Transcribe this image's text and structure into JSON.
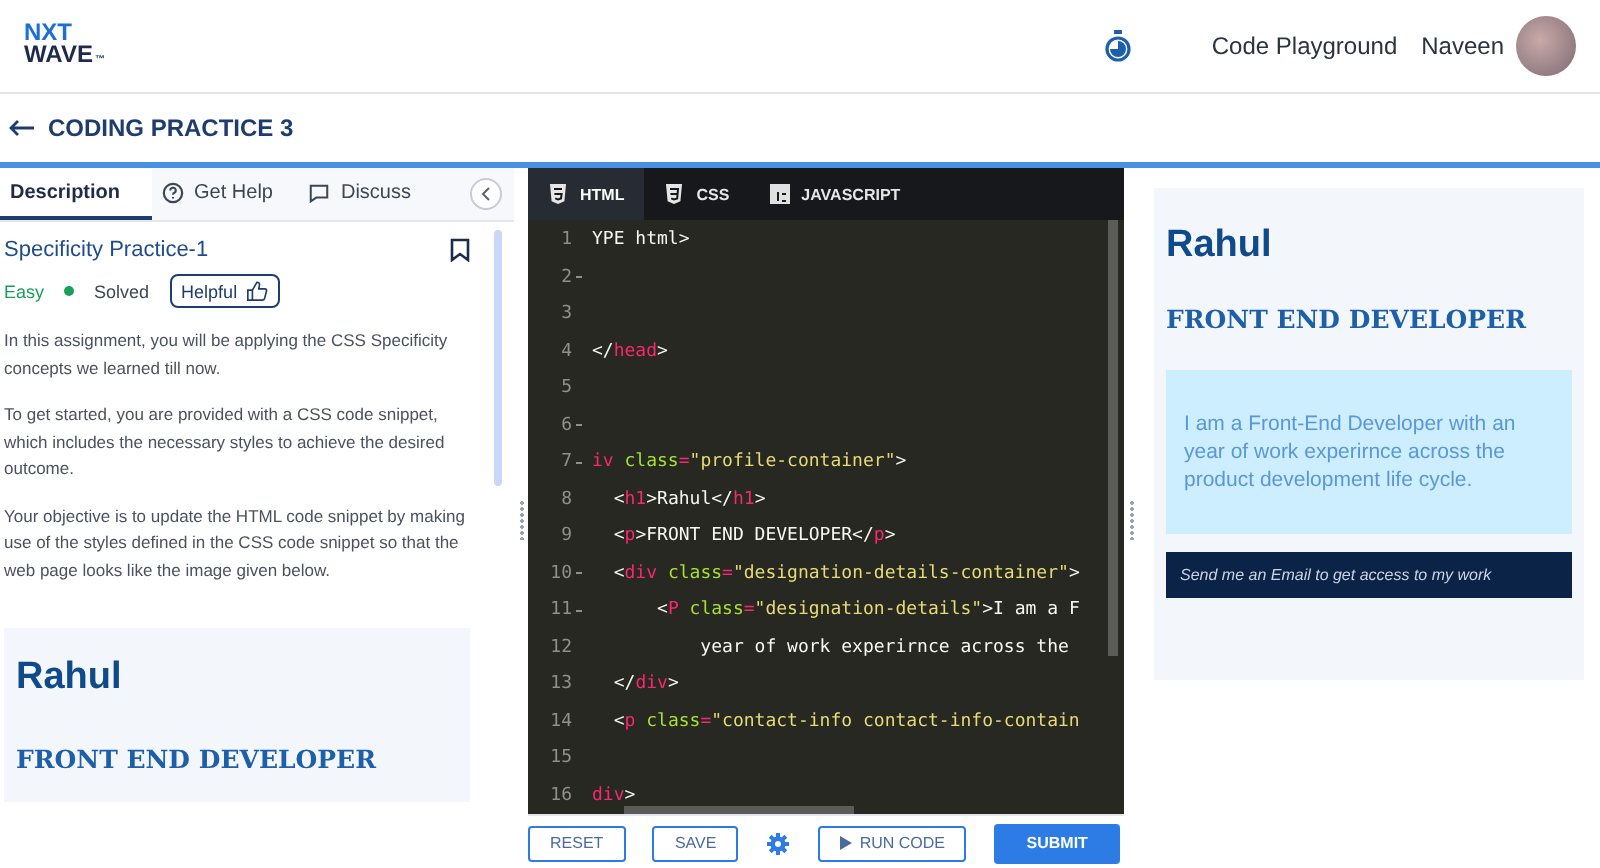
{
  "header": {
    "logo": {
      "top": "NXT",
      "bottom": "WAVE",
      "mark": "™"
    },
    "links": [
      "Code Playground"
    ],
    "user": {
      "name": "Naveen"
    }
  },
  "page_title": "CODING PRACTICE 3",
  "left_tabs": [
    {
      "label": "Description",
      "selected": true,
      "kind": "plain"
    },
    {
      "label": "Get Help",
      "selected": false,
      "kind": "help"
    },
    {
      "label": "Discuss",
      "selected": false,
      "kind": "chat"
    }
  ],
  "problem": {
    "title": "Specificity Practice-1",
    "bookmarked": false,
    "difficulty": "Easy",
    "status": "Solved",
    "helpful": "Helpful",
    "paragraphs": [
      "In this assignment, you will be applying the CSS Specificity concepts we learned till now.",
      "To get started, you are provided with a CSS code snippet, which includes the necessary styles to achieve the desired outcome.",
      "Your objective is to update the HTML code snippet by making use of the styles defined in the CSS code snippet so that the web page looks like the image given below."
    ],
    "sample": {
      "name": "Rahul",
      "role": "FRONT END DEVELOPER"
    }
  },
  "editor_tabs": [
    {
      "label": "HTML",
      "selected": true,
      "kind": "html"
    },
    {
      "label": "CSS",
      "selected": false,
      "kind": "css"
    },
    {
      "label": "JAVASCRIPT",
      "selected": false,
      "kind": "js"
    }
  ],
  "code_lines": [
    {
      "number": "1",
      "fold": false,
      "segments": [
        {
          "kind": "text",
          "text": "YPE html>"
        }
      ]
    },
    {
      "number": "2",
      "fold": true
    },
    {
      "number": "3",
      "fold": false
    },
    {
      "number": "4",
      "fold": false,
      "segments": [
        {
          "kind": "text",
          "text": "</"
        },
        {
          "kind": "tag",
          "text": "head"
        },
        {
          "kind": "text",
          "text": ">"
        }
      ]
    },
    {
      "number": "5",
      "fold": false
    },
    {
      "number": "6",
      "fold": true
    },
    {
      "number": "7",
      "fold": true,
      "segments": [
        {
          "kind": "tag",
          "text": "iv"
        },
        {
          "kind": "attr",
          "text": " class"
        },
        {
          "kind": "tag",
          "text": "="
        },
        {
          "kind": "string",
          "text": "\"profile-container\""
        },
        {
          "kind": "text",
          "text": ">"
        }
      ]
    },
    {
      "number": "8",
      "fold": false,
      "segments": [
        {
          "kind": "text",
          "text": "  <"
        },
        {
          "kind": "tag",
          "text": "h1"
        },
        {
          "kind": "text",
          "text": ">Rahul</"
        },
        {
          "kind": "tag",
          "text": "h1"
        },
        {
          "kind": "text",
          "text": ">"
        }
      ]
    },
    {
      "number": "9",
      "fold": false,
      "segments": [
        {
          "kind": "text",
          "text": "  <"
        },
        {
          "kind": "tag",
          "text": "p"
        },
        {
          "kind": "text",
          "text": ">FRONT END DEVELOPER</"
        },
        {
          "kind": "tag",
          "text": "p"
        },
        {
          "kind": "text",
          "text": ">"
        }
      ]
    },
    {
      "number": "10",
      "fold": true,
      "segments": [
        {
          "kind": "text",
          "text": "  <"
        },
        {
          "kind": "tag",
          "text": "div"
        },
        {
          "kind": "attr",
          "text": " class"
        },
        {
          "kind": "tag",
          "text": "="
        },
        {
          "kind": "string",
          "text": "\"designation-details-container\""
        },
        {
          "kind": "text",
          "text": ">"
        }
      ]
    },
    {
      "number": "11",
      "fold": true,
      "segments": [
        {
          "kind": "text",
          "text": "      <"
        },
        {
          "kind": "tag",
          "text": "P"
        },
        {
          "kind": "attr",
          "text": " class"
        },
        {
          "kind": "tag",
          "text": "="
        },
        {
          "kind": "string",
          "text": "\"designation-details\""
        },
        {
          "kind": "text",
          "text": ">I am a F"
        }
      ]
    },
    {
      "number": "12",
      "fold": false,
      "segments": [
        {
          "kind": "text",
          "text": "          year of work experirnce across the"
        }
      ]
    },
    {
      "number": "13",
      "fold": false,
      "segments": [
        {
          "kind": "text",
          "text": "  </"
        },
        {
          "kind": "tag",
          "text": "div"
        },
        {
          "kind": "text",
          "text": ">"
        }
      ]
    },
    {
      "number": "14",
      "fold": false,
      "segments": [
        {
          "kind": "text",
          "text": "  <"
        },
        {
          "kind": "tag",
          "text": "p"
        },
        {
          "kind": "attr",
          "text": " class"
        },
        {
          "kind": "tag",
          "text": "="
        },
        {
          "kind": "string",
          "text": "\"contact-info contact-info-contain"
        }
      ]
    },
    {
      "number": "15",
      "fold": false
    },
    {
      "number": "16",
      "fold": false,
      "segments": [
        {
          "kind": "tag",
          "text": "div"
        },
        {
          "kind": "text",
          "text": ">"
        }
      ]
    }
  ],
  "editor_buttons": [
    {
      "label": "RESET",
      "kind": "outline"
    },
    {
      "label": "SAVE",
      "kind": "outline"
    },
    {
      "kind": "settings"
    },
    {
      "label": "RUN CODE",
      "kind": "run"
    },
    {
      "label": "SUBMIT",
      "kind": "primary"
    }
  ],
  "preview": {
    "name": "Rahul",
    "role": "FRONT END DEVELOPER",
    "details": "I am a Front-End Developer with an year of work experirnce across the product development life cycle.",
    "contact": "Send me an Email to get access to my work"
  }
}
